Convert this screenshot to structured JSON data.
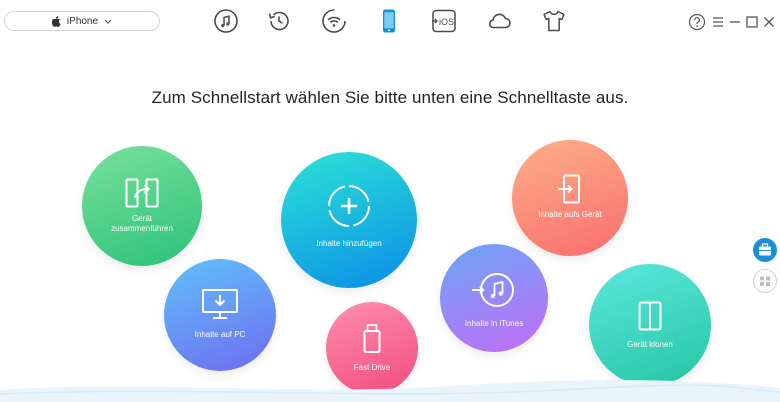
{
  "device_selector": {
    "name": "iPhone"
  },
  "toolbar": {
    "icons": [
      "music-icon",
      "history-icon",
      "wifi-sync-icon",
      "phone-icon",
      "ios-mover-icon",
      "cloud-icon",
      "tshirt-icon"
    ],
    "active": "phone-icon",
    "ios_label": "iOS"
  },
  "window_controls": [
    "help-icon",
    "menu-icon",
    "minimize-icon",
    "maximize-icon",
    "close-icon"
  ],
  "headline": "Zum Schnellstart wählen Sie bitte unten eine Schnelltaste aus.",
  "quick_actions": {
    "merge": {
      "label_line1": "Gerät",
      "label_line2": "zusammenführen"
    },
    "add_content": {
      "label": "Inhalte hinzufügen"
    },
    "to_device": {
      "label": "Inhalte aufs Gerät"
    },
    "to_pc": {
      "label": "Inhalte auf PC"
    },
    "fast_drive": {
      "label": "Fast Drive"
    },
    "to_itunes": {
      "label": "Inhalte in iTunes"
    },
    "clone": {
      "label": "Gerät klonen"
    }
  },
  "colors": {
    "accent": "#1a8fd8",
    "merge": "#2bc27b",
    "add_content": "#0b8de8",
    "to_device": "#fb6d6d",
    "to_pc": "#6f6cf1",
    "fast_drive": "#f34b7e",
    "to_itunes": "#c46cf6",
    "clone": "#24c6a2"
  },
  "side_buttons": [
    "toolbox-icon",
    "grid-icon"
  ]
}
